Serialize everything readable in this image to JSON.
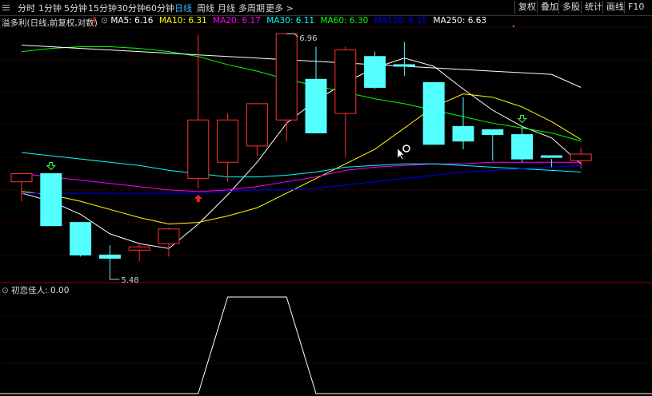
{
  "toolbar": {
    "periods": [
      "分时",
      "1分钟",
      "5分钟",
      "15分钟",
      "30分钟",
      "60分钟",
      "日线",
      "周线",
      "月线",
      "多周期",
      "更多 >"
    ],
    "active_period": "日线",
    "right_buttons": [
      "复权",
      "叠加",
      "多股",
      "统计",
      "画线",
      "F10"
    ]
  },
  "main_chart": {
    "title": "溢多利(日线,前复权,对数)",
    "ma_labels": [
      {
        "text": "MA5: 6.16",
        "color": "#ffffff"
      },
      {
        "text": "MA10: 6.31",
        "color": "#ffff00"
      },
      {
        "text": "MA20: 6.17",
        "color": "#ff00ff"
      },
      {
        "text": "MA30: 6.11",
        "color": "#00ffff"
      },
      {
        "text": "MA60: 6.30",
        "color": "#00ff00"
      },
      {
        "text": "MA120: 6.15",
        "color": "#0000ff"
      },
      {
        "text": "MA250: 6.63",
        "color": "#ffffff"
      }
    ],
    "high_label": "6.96",
    "low_label": "5.48"
  },
  "indicator": {
    "title": "初恋佳人",
    "value": ": 0.00"
  },
  "chart_data": {
    "type": "candlestick",
    "title": "溢多利(日线,前复权,对数)",
    "y_high_marker": 6.96,
    "y_low_marker": 5.48,
    "candles": [
      {
        "o": 6.05,
        "h": 6.1,
        "l": 5.93,
        "c": 6.1
      },
      {
        "o": 6.1,
        "h": 6.1,
        "l": 5.78,
        "c": 5.78
      },
      {
        "o": 5.8,
        "h": 5.8,
        "l": 5.59,
        "c": 5.6
      },
      {
        "o": 5.6,
        "h": 5.66,
        "l": 5.48,
        "c": 5.58
      },
      {
        "o": 5.63,
        "h": 5.67,
        "l": 5.56,
        "c": 5.65
      },
      {
        "o": 5.67,
        "h": 5.77,
        "l": 5.59,
        "c": 5.76
      },
      {
        "o": 6.07,
        "h": 6.95,
        "l": 6.01,
        "c": 6.43
      },
      {
        "o": 6.17,
        "h": 6.47,
        "l": 6.05,
        "c": 6.43
      },
      {
        "o": 6.27,
        "h": 6.5,
        "l": 6.21,
        "c": 6.53
      },
      {
        "o": 6.43,
        "h": 6.96,
        "l": 6.3,
        "c": 6.96
      },
      {
        "o": 6.68,
        "h": 6.88,
        "l": 6.39,
        "c": 6.35
      },
      {
        "o": 6.47,
        "h": 6.88,
        "l": 6.2,
        "c": 6.86
      },
      {
        "o": 6.82,
        "h": 6.85,
        "l": 6.62,
        "c": 6.63
      },
      {
        "o": 6.77,
        "h": 6.91,
        "l": 6.7,
        "c": 6.76
      },
      {
        "o": 6.66,
        "h": 6.66,
        "l": 6.28,
        "c": 6.28
      },
      {
        "o": 6.39,
        "h": 6.57,
        "l": 6.25,
        "c": 6.3
      },
      {
        "o": 6.37,
        "h": 6.37,
        "l": 6.18,
        "c": 6.34
      },
      {
        "o": 6.34,
        "h": 6.39,
        "l": 6.17,
        "c": 6.19
      },
      {
        "o": 6.21,
        "h": 6.19,
        "l": 6.14,
        "c": 6.2
      },
      {
        "o": 6.18,
        "h": 6.26,
        "l": 6.13,
        "c": 6.22
      }
    ],
    "ma_series": [
      {
        "name": "MA5",
        "color": "#ffffff",
        "values": [
          5.98,
          5.93,
          5.85,
          5.73,
          5.67,
          5.64,
          5.79,
          5.97,
          6.17,
          6.41,
          6.55,
          6.66,
          6.75,
          6.81,
          6.76,
          6.62,
          6.49,
          6.39,
          6.32,
          6.16
        ]
      },
      {
        "name": "MA10",
        "color": "#ffff00",
        "values": [
          5.99,
          5.97,
          5.93,
          5.88,
          5.83,
          5.79,
          5.8,
          5.84,
          5.89,
          5.98,
          6.07,
          6.16,
          6.25,
          6.38,
          6.51,
          6.59,
          6.57,
          6.51,
          6.42,
          6.31
        ]
      },
      {
        "name": "MA20",
        "color": "#ff00ff",
        "values": [
          6.1,
          6.08,
          6.06,
          6.04,
          6.02,
          6.0,
          5.99,
          6.0,
          6.02,
          6.05,
          6.08,
          6.12,
          6.14,
          6.15,
          6.16,
          6.16,
          6.17,
          6.17,
          6.17,
          6.17
        ]
      },
      {
        "name": "MA30",
        "color": "#00ffff",
        "values": [
          6.23,
          6.21,
          6.19,
          6.17,
          6.15,
          6.12,
          6.1,
          6.08,
          6.08,
          6.09,
          6.11,
          6.14,
          6.15,
          6.16,
          6.16,
          6.15,
          6.14,
          6.13,
          6.12,
          6.11
        ]
      },
      {
        "name": "MA60",
        "color": "#00ff00",
        "values": [
          6.85,
          6.87,
          6.88,
          6.88,
          6.87,
          6.85,
          6.82,
          6.77,
          6.73,
          6.68,
          6.64,
          6.6,
          6.56,
          6.53,
          6.49,
          6.45,
          6.41,
          6.38,
          6.35,
          6.3
        ]
      },
      {
        "name": "MA120",
        "color": "#0000ff",
        "values": [
          5.98,
          5.98,
          5.98,
          5.98,
          5.98,
          5.98,
          5.98,
          5.99,
          6.0,
          6.0,
          6.01,
          6.03,
          6.05,
          6.07,
          6.09,
          6.11,
          6.12,
          6.13,
          6.14,
          6.15
        ]
      },
      {
        "name": "MA250",
        "color": "#ffffff",
        "values": [
          6.89,
          6.88,
          6.87,
          6.86,
          6.85,
          6.84,
          6.83,
          6.82,
          6.81,
          6.8,
          6.79,
          6.78,
          6.77,
          6.76,
          6.75,
          6.74,
          6.73,
          6.72,
          6.71,
          6.63
        ]
      }
    ],
    "signals": [
      {
        "index": 1,
        "type": "down"
      },
      {
        "index": 6,
        "type": "up"
      },
      {
        "index": 17,
        "type": "down"
      }
    ],
    "indicator_values": [
      0,
      0,
      0,
      0,
      0,
      0,
      0,
      1,
      1,
      1,
      0,
      0,
      0,
      0,
      0,
      0,
      0,
      0,
      0,
      0
    ]
  }
}
